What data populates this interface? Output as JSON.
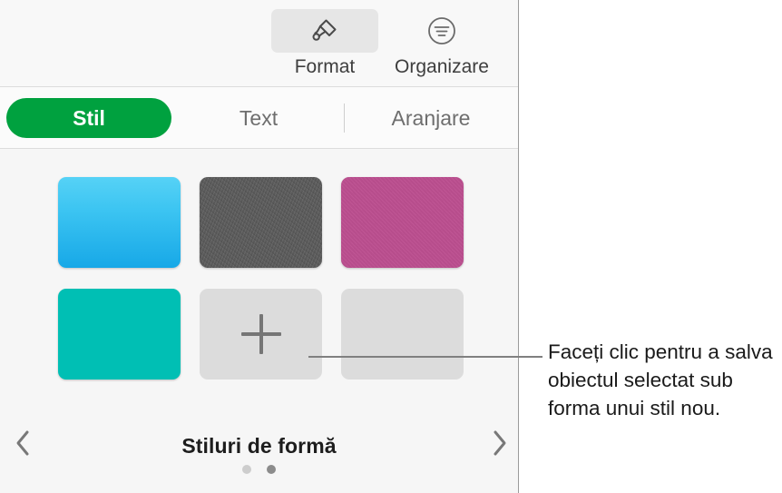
{
  "panel": {
    "toolbar": {
      "items": [
        {
          "label": "Format",
          "icon": "paintbrush-icon",
          "selected": true
        },
        {
          "label": "Organizare",
          "icon": "arrange-align-icon",
          "selected": false
        }
      ]
    },
    "tabs": [
      {
        "label": "Stil",
        "selected": true
      },
      {
        "label": "Text",
        "selected": false
      },
      {
        "label": "Aranjare",
        "selected": false
      }
    ],
    "styles": {
      "caption": "Stiluri de formă",
      "prev_icon": "chevron-left-icon",
      "next_icon": "chevron-right-icon",
      "swatches": [
        {
          "name": "blue-gradient",
          "color": "#3dc5f2"
        },
        {
          "name": "gray-texture",
          "color": "#5b5b5b"
        },
        {
          "name": "pink",
          "color": "#bd4f90"
        },
        {
          "name": "teal",
          "color": "#00bfb4"
        },
        {
          "name": "add-style",
          "color": "#dcdcdc",
          "icon": "plus-icon"
        },
        {
          "name": "empty-slot",
          "color": "#dcdcdc"
        }
      ],
      "page_dots": [
        {
          "active": false
        },
        {
          "active": true
        }
      ]
    }
  },
  "callout": {
    "text": "Faceți clic pentru a salva obiectul selectat sub forma unui stil nou."
  },
  "colors": {
    "accent_green": "#00a13f",
    "panel_background": "#f6f6f6",
    "text_primary": "#1a1a1a",
    "text_secondary": "#6e6e6e"
  }
}
